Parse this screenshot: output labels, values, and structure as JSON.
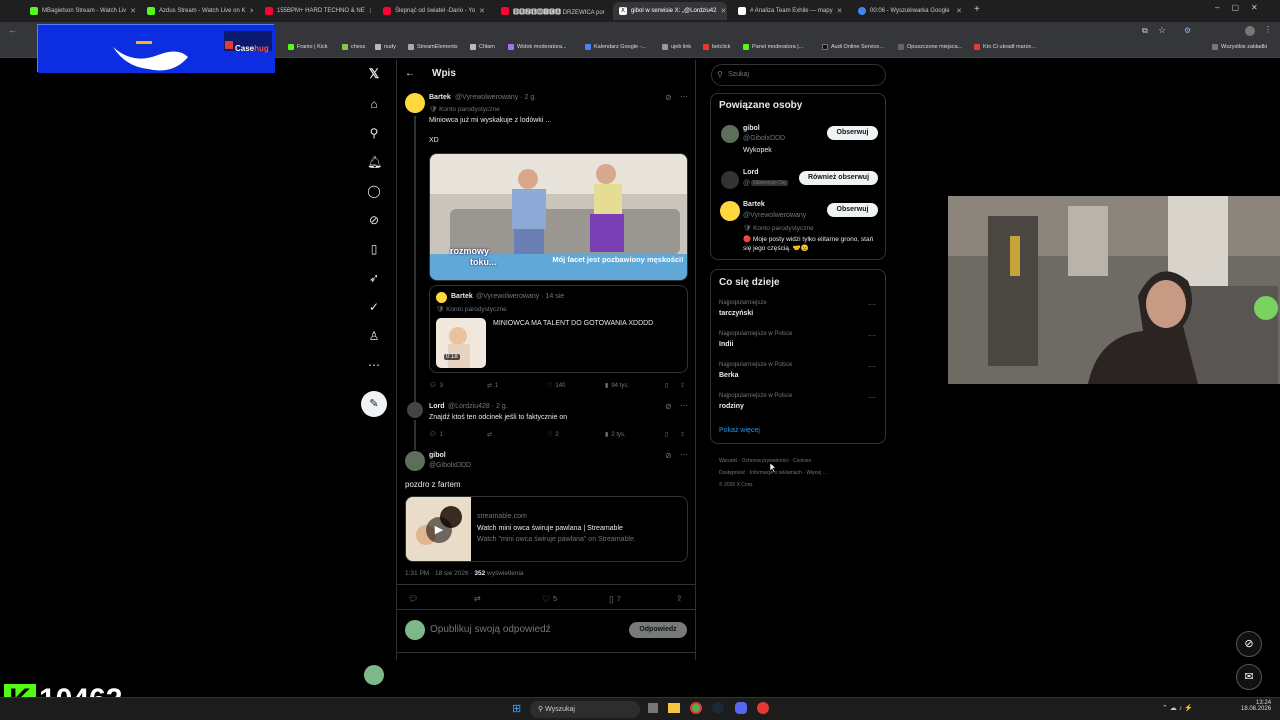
{
  "colors": {
    "accent": "#1d9bf0",
    "bg": "#000000",
    "kick": "#53fc18",
    "border": "#2f3336"
  },
  "tabs": [
    {
      "label": "MBagietson Stream - Watch Liv",
      "fav": "#53fc18"
    },
    {
      "label": "Azdus Stream - Watch Live on K",
      "fav": "#53fc18"
    },
    {
      "label": "155BPM+ HARD TECHNO & NE",
      "fav": "#ff0033"
    },
    {
      "label": "Ślepnąć od świateł -Dario - Yo",
      "fav": "#ff0033"
    },
    {
      "label": "🅳🆁🆉🅴🆆🅸🅲🅰 DRZEWICA por",
      "fav": "#ff0033"
    },
    {
      "label": "gibol w serwisie X: „@Lordziu42",
      "fav": "#ffffff",
      "active": true
    },
    {
      "label": "# Analiza Team Exhile — mapy",
      "fav": "#ffffff"
    },
    {
      "label": "00:06 - Wyszukiwarka Google",
      "fav": "#4285f4"
    }
  ],
  "bookmarks": [
    "Franio | Kick",
    "chess",
    "nudy",
    "StreamElements",
    "Chłam",
    "Widok moderatora...",
    "Kalendarz Google -...",
    "ujeb link",
    "betclick",
    "Panel moderatora |...",
    "Audi Online Service...",
    "Opuszczone miejsca...",
    "Kto Ci ukradł marze...",
    "Wszystkie zakładki"
  ],
  "promo": {
    "brand": "Case",
    "brand2": "hug"
  },
  "header": {
    "title": "Wpis"
  },
  "post1": {
    "name": "Bartek",
    "handle": "@Vyrewolwerowany · 2 g.",
    "badge": "Konto parodystyczne",
    "text1": "Miniowca już mi wyskakuje z lodówki ...",
    "text2": "XD",
    "image_caption1": "rozmowy",
    "image_caption2": "toku...",
    "image_subtitle": "Mój facet jest pozbawiony męskości!",
    "quote_name": "Bartek",
    "quote_handle": "@Vyrewolwerowany · 14 sie",
    "quote_badge": "Konto parodystyczne",
    "quote_text": "MINIOWCA MA TALENT DO GOTOWANIA XDDDD",
    "quote_duration": "0:18",
    "replies": "3",
    "reposts": "1",
    "likes": "140",
    "views": "94 tys."
  },
  "post2": {
    "name": "Lord",
    "handle": "@Lordziu428 · 2 g.",
    "text": "Znajdź ktoś ten odcinek jeśli to faktycznie on",
    "replies": "1",
    "reposts": "",
    "likes": "2",
    "views": "2 tys."
  },
  "post3": {
    "name": "gibol",
    "handle": "@GibolxDDD",
    "text": "pozdro z fartem",
    "card_domain": "streamable.com",
    "card_title": "Watch mini owca świruje pawlana | Streamable",
    "card_desc": "Watch \"mini owca świruje pawlana\" on Streamable.",
    "meta_time": "1:31 PM · 18 sie 2026 · ",
    "meta_views": "352",
    "meta_views_label": " wyświetlenia",
    "likes": "5",
    "bookmarks": "7"
  },
  "reply": {
    "placeholder": "Opublikuj swoją odpowiedź",
    "button": "Odpowiedz"
  },
  "search": {
    "placeholder": "Szukaj"
  },
  "related": {
    "title": "Powiązane osoby",
    "people": [
      {
        "name": "gibol",
        "handle": "@GibolxDDD",
        "bio": "Wykopek",
        "button": "Obserwuj"
      },
      {
        "name": "Lord",
        "handle": "@",
        "follows_you": "Obserwuje Cię",
        "bio": "",
        "button": "Również obserwuj"
      },
      {
        "name": "Bartek",
        "handle": "@Vyrewolwerowany",
        "badge": "Konto parodystyczne",
        "bio": "🔴 Moje posty widzi tylko elitarne grono, stań się jego częścią. 🤝😉",
        "button": "Obserwuj"
      }
    ]
  },
  "trends": {
    "title": "Co się dzieje",
    "items": [
      {
        "context": "Najpopularniejsze",
        "name": "tarczyński"
      },
      {
        "context": "Najpopularniejsze w Polsce",
        "name": "Indii"
      },
      {
        "context": "Najpopularniejsze w Polsce",
        "name": "Berka"
      },
      {
        "context": "Najpopularniejsze w Polsce",
        "name": "rodziny"
      }
    ],
    "more": "Pokaż więcej"
  },
  "footer": {
    "l1": [
      "Warunki",
      "Ochrona prywatności",
      "Cookies"
    ],
    "l2": [
      "Dostępność",
      "Informacje o reklamach",
      "Więcej ..."
    ],
    "copy": "© 2026 X Corp."
  },
  "overlay": {
    "counter": "10462"
  },
  "taskbar": {
    "search": "Wyszukaj",
    "time": "13:24",
    "date": "18.08.2026"
  }
}
